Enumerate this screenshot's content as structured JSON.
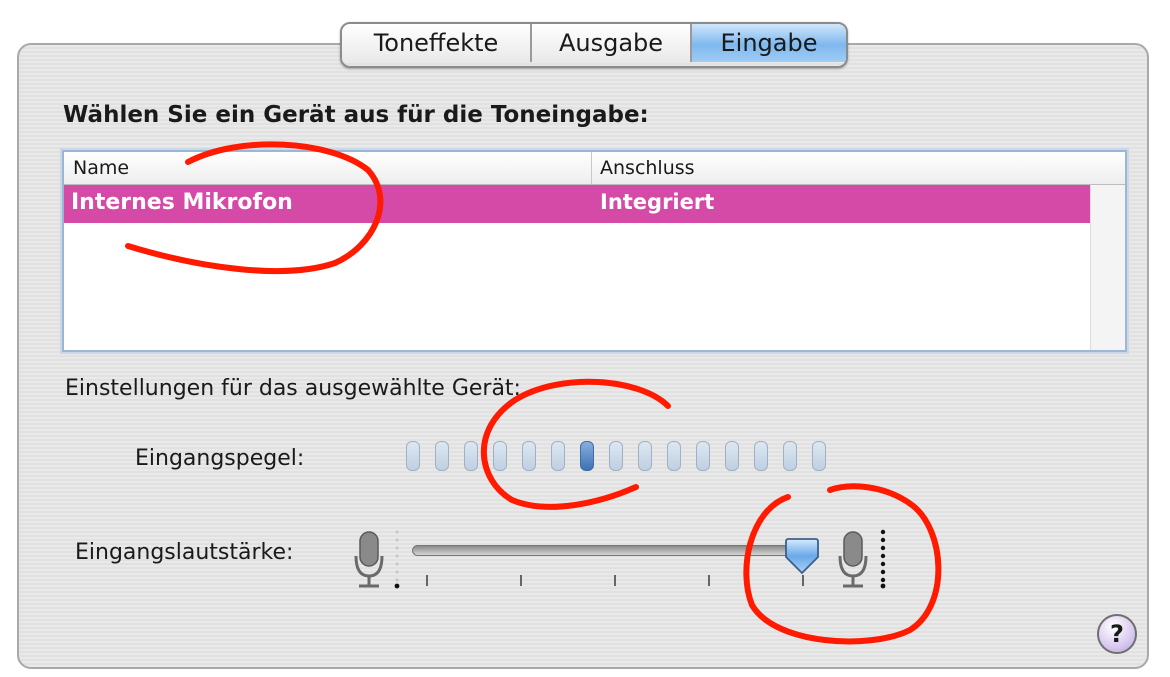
{
  "tabs": [
    {
      "label": "Toneffekte",
      "active": false
    },
    {
      "label": "Ausgabe",
      "active": false
    },
    {
      "label": "Eingabe",
      "active": true
    }
  ],
  "heading": "Wählen Sie ein Gerät aus für die Toneingabe:",
  "device_table": {
    "columns": [
      "Name",
      "Anschluss"
    ],
    "rows": [
      {
        "name": "Internes Mikrofon",
        "connection": "Integriert",
        "selected": true
      }
    ]
  },
  "settings_label": "Einstellungen für das ausgewählte Gerät:",
  "input_level": {
    "label": "Eingangspegel:",
    "segments": 15,
    "active_segment": 7
  },
  "input_volume": {
    "label": "Eingangslautstärke:",
    "value_fraction": 0.93,
    "min_icon": "microphone-icon",
    "max_icon": "microphone-icon"
  },
  "help_button": {
    "label": "?"
  },
  "colors": {
    "selection": "#d64aa7",
    "active_tab": "#7fb8ee",
    "level_on": "#3e72b5",
    "annotation": "#ff1a00"
  }
}
